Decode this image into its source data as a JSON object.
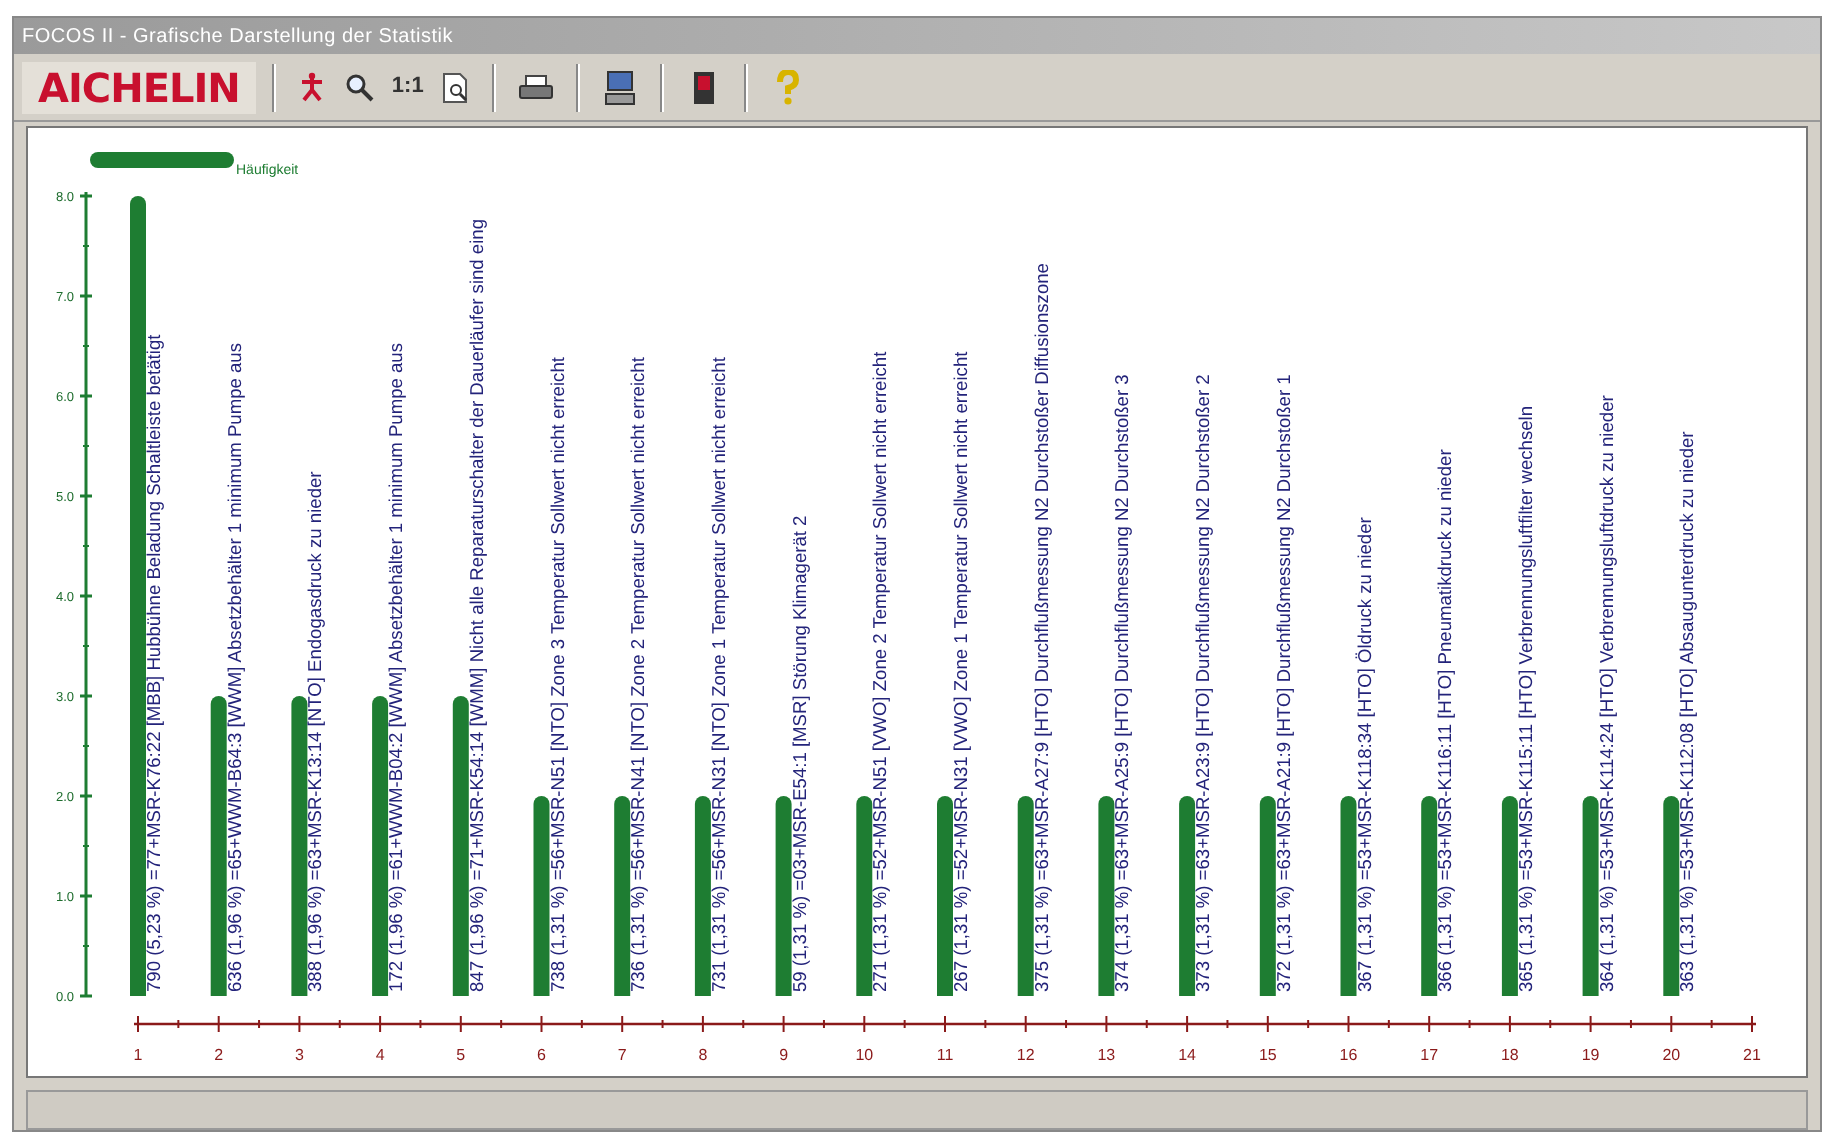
{
  "window": {
    "title": "FOCOS II - Grafische Darstellung der Statistik"
  },
  "toolbar": {
    "logo": "AICHELIN",
    "zoom_label": "1:1"
  },
  "chart": {
    "chart_data": {
      "type": "bar",
      "x": [
        1,
        2,
        3,
        4,
        5,
        6,
        7,
        8,
        9,
        10,
        11,
        12,
        13,
        14,
        15,
        16,
        17,
        18,
        19,
        20
      ],
      "series": [
        {
          "name": "Häufigkeit",
          "color": "#1e7d32",
          "values": [
            8,
            3,
            3,
            3,
            3,
            2,
            2,
            2,
            2,
            2,
            2,
            2,
            2,
            2,
            2,
            2,
            2,
            2,
            2,
            2
          ]
        }
      ],
      "xticks": [
        1,
        2,
        3,
        4,
        5,
        6,
        7,
        8,
        9,
        10,
        11,
        12,
        13,
        14,
        15,
        16,
        17,
        18,
        19,
        20,
        21
      ],
      "xlim": [
        1,
        21
      ],
      "ylim": [
        0,
        8
      ],
      "yticks": [
        {
          "value": 0,
          "label": "0.0"
        },
        {
          "value": 1,
          "label": "1.0"
        },
        {
          "value": 2,
          "label": "2.0"
        },
        {
          "value": 3,
          "label": "3.0"
        },
        {
          "value": 4,
          "label": "4.0"
        },
        {
          "value": 5,
          "label": "5.0"
        },
        {
          "value": 6,
          "label": "6.0"
        },
        {
          "value": 7,
          "label": "7.0"
        },
        {
          "value": 8,
          "label": "8.0"
        }
      ]
    },
    "bar_labels": [
      "790 (5,23 %)  =77+MSR-K76:22 [MBB] Hubbühne Beladung Schaltleiste betätigt",
      "636 (1,96 %)  =65+WWM-B64:3 [WWM] Absetzbehälter 1 minimum Pumpe aus",
      "388 (1,96 %)  =63+MSR-K13:14 [NTO] Endogasdruck zu nieder",
      "172 (1,96 %)  =61+WWM-B04:2 [WWM] Absetzbehälter 1 minimum Pumpe aus",
      "847 (1,96 %)  =71+MSR-K54:14 [WMM] Nicht alle Reparaturschalter der Dauerläufer sind eing",
      "738 (1,31 %)  =56+MSR-N51 [NTO] Zone 3 Temperatur Sollwert nicht erreicht",
      "736 (1,31 %)  =56+MSR-N41 [NTO] Zone 2 Temperatur Sollwert nicht erreicht",
      "731 (1,31 %)  =56+MSR-N31 [NTO] Zone 1 Temperatur Sollwert nicht erreicht",
      "59 (1,31 %)  =03+MSR-E54:1 [MSR] Störung Klimagerät 2",
      "271 (1,31 %)  =52+MSR-N51 [VWO] Zone 2 Temperatur Sollwert nicht erreicht",
      "267 (1,31 %)  =52+MSR-N31 [VWO] Zone 1 Temperatur Sollwert nicht erreicht",
      "375 (1,31 %)  =63+MSR-A27:9 [HTO] Durchflußmessung N2 Durchstoßer Diffusionszone",
      "374 (1,31 %)  =63+MSR-A25:9 [HTO] Durchflußmessung N2 Durchstoßer 3",
      "373 (1,31 %)  =63+MSR-A23:9 [HTO] Durchflußmessung N2 Durchstoßer 2",
      "372 (1,31 %)  =63+MSR-A21:9 [HTO] Durchflußmessung N2 Durchstoßer 1",
      "367 (1,31 %)  =53+MSR-K118:34 [HTO] Öldruck zu nieder",
      "366 (1,31 %)  =53+MSR-K116:11 [HTO] Pneumatikdruck zu nieder",
      "365 (1,31 %)  =53+MSR-K115:11 [HTO] Verbrennungsluftfilter wechseln",
      "364 (1,31 %)  =53+MSR-K114:24 [HTO] Verbrennungsluftdruck zu nieder",
      "363 (1,31 %)  =53+MSR-K112:08 [HTO] Absaugunterdruck zu nieder"
    ]
  }
}
